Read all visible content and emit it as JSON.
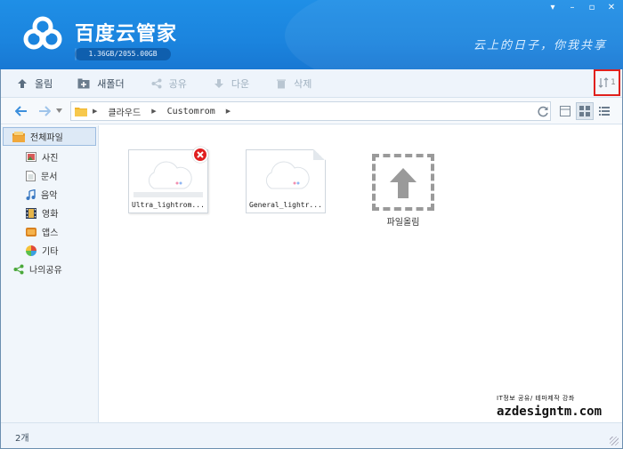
{
  "app": {
    "title": "百度云管家",
    "quota": "1.36GB/2055.00GB",
    "quota_fraction": 0.0007,
    "slogan": "云上的日子，你我共享"
  },
  "window_controls": [
    "minimize",
    "restore",
    "close"
  ],
  "toolbar": {
    "upload": "올림",
    "new_folder": "새폴더",
    "share": "공유",
    "download": "다운",
    "delete": "삭제",
    "right_label": "1"
  },
  "address": {
    "segments": [
      "클라우드",
      "Customrom"
    ]
  },
  "sidebar": {
    "all_files": "전체파일",
    "items": [
      "사진",
      "문서",
      "음악",
      "영화",
      "앱스",
      "기타"
    ],
    "my_share": "나의공유"
  },
  "files": [
    {
      "name": "Ultra_lightrom...",
      "error": true
    },
    {
      "name": "General_lightr...",
      "error": false
    }
  ],
  "upload_tile": {
    "label": "파일올림"
  },
  "watermark": {
    "line1": "IT정보 공유/ 테마제작 강좌",
    "line2": "azdesigntm.com"
  },
  "status": {
    "count": "2개"
  },
  "colors": {
    "header": "#1b84de",
    "accent": "#1f8fe6",
    "error": "#e02020",
    "highlight": "#e0201c"
  }
}
